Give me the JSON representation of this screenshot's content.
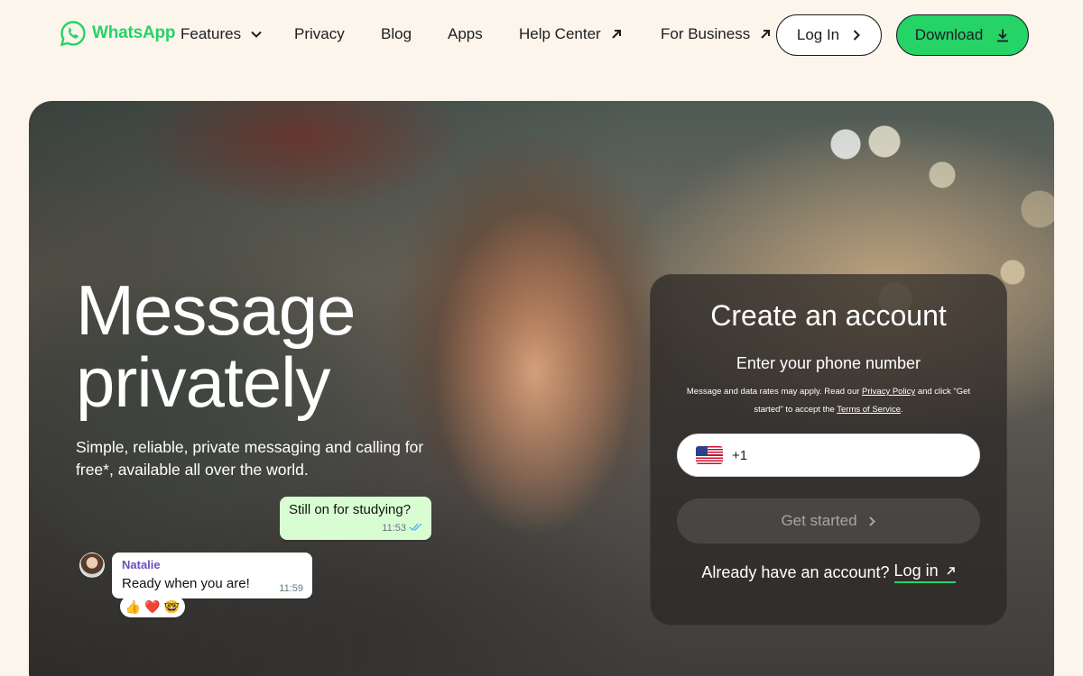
{
  "nav": {
    "brand": "WhatsApp",
    "items": [
      {
        "label": "Features"
      },
      {
        "label": "Privacy"
      },
      {
        "label": "Blog"
      },
      {
        "label": "Apps"
      },
      {
        "label": "Help Center"
      },
      {
        "label": "For Business"
      }
    ],
    "login_label": "Log In",
    "download_label": "Download"
  },
  "hero": {
    "title": "Message\nprivately",
    "subtitle": "Simple, reliable, private messaging and calling for free*, available all over the world."
  },
  "chat": {
    "outgoing": {
      "text": "Still on for studying?",
      "time": "11:53"
    },
    "incoming": {
      "name": "Natalie",
      "text": "Ready when you are!",
      "time": "11:59"
    },
    "reactions": [
      "👍",
      "❤️",
      "🤓"
    ]
  },
  "account_card": {
    "title": "Create an account",
    "subtitle": "Enter your phone number",
    "fine_print_1": "Message and data rates may apply. Read our",
    "privacy_policy": "Privacy Policy",
    "fine_print_2": "and click \"Get started\" to accept the",
    "terms": "Terms of Service",
    "fine_print_3": ".",
    "dial_code": "+1",
    "get_started": "Get started",
    "have_account": "Already have an account?",
    "login_link": "Log in"
  },
  "colors": {
    "brand_green": "#25d366",
    "page_bg": "#fcf5eb",
    "bubble_out": "#d9fdd3"
  }
}
